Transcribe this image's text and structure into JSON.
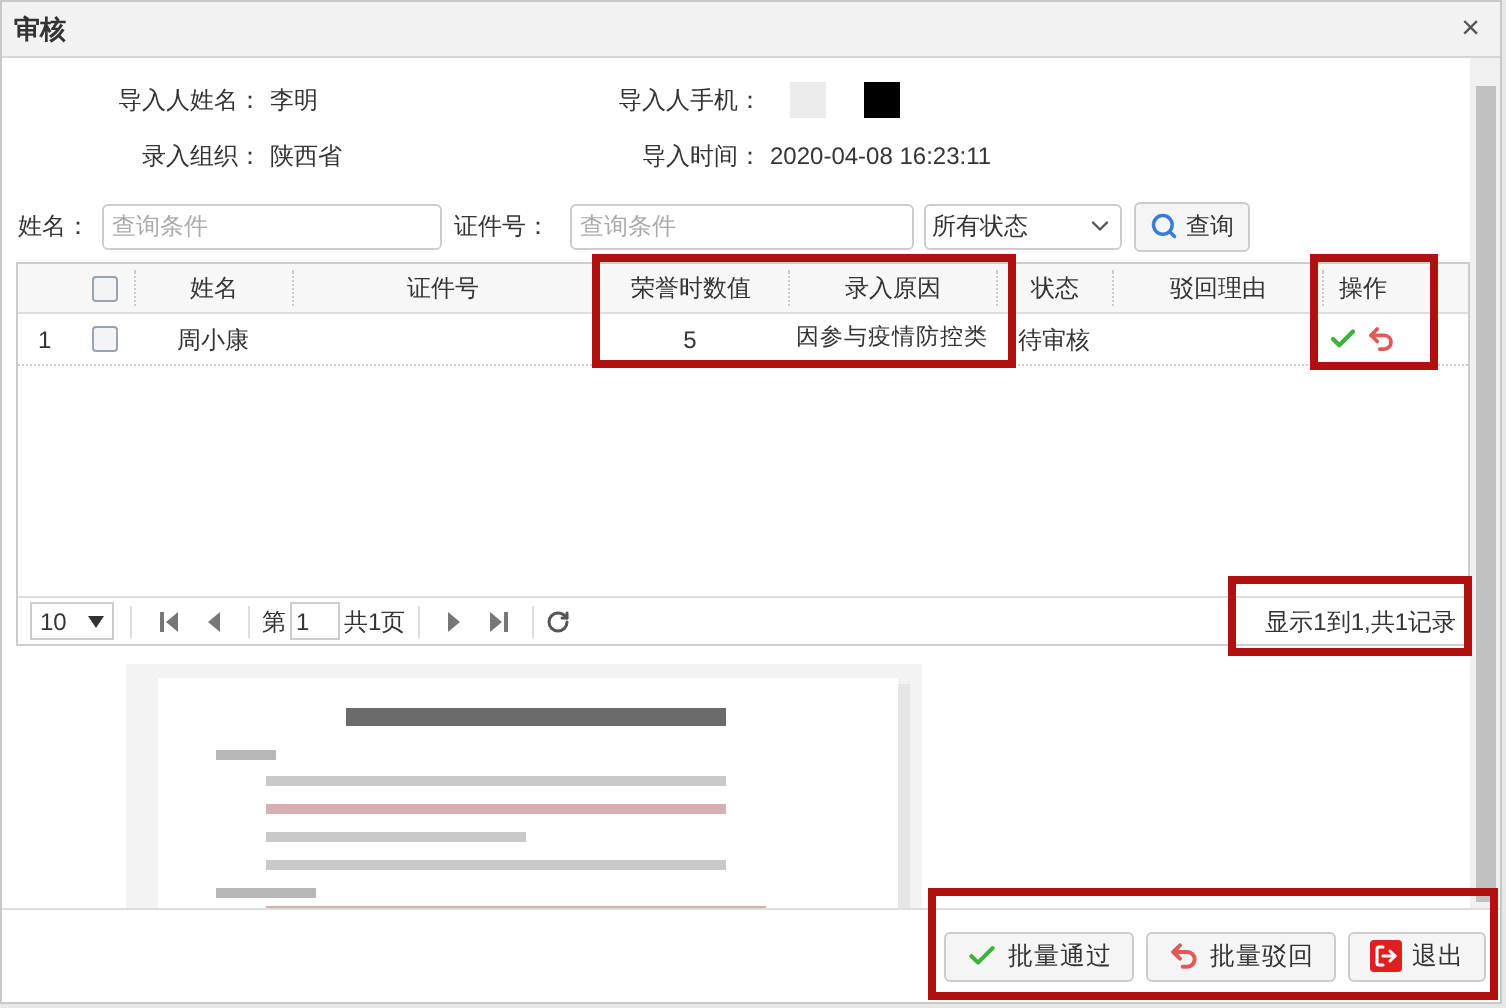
{
  "dialog": {
    "title": "审核",
    "close": "×"
  },
  "info": [
    [
      {
        "label": "导入人姓名：",
        "value": "李明"
      },
      {
        "label": "导入人手机：",
        "kind": "redacted"
      }
    ],
    [
      {
        "label": "录入组织：",
        "value": "陕西省"
      },
      {
        "label": "导入时间：",
        "value": "2020-04-08 16:23:11"
      }
    ]
  ],
  "filters": {
    "name_label": "姓名：",
    "name_placeholder": "查询条件",
    "id_label": "证件号：",
    "id_placeholder": "查询条件",
    "status": "所有状态",
    "search": "查询"
  },
  "table": {
    "all_checked": false,
    "columns": [
      "姓名",
      "证件号",
      "荣誉时数值",
      "录入原因",
      "状态",
      "驳回理由",
      "操作"
    ],
    "rows": [
      {
        "index": "1",
        "checked": false,
        "name": "周小康",
        "hours": "5",
        "reason": "因参与疫情防控类",
        "status": "待审核"
      }
    ]
  },
  "pager": {
    "page_size": "10",
    "page_prefix": "第",
    "page": "1",
    "page_suffix": "共1页",
    "summary": "显示1到1,共1记录"
  },
  "attachment": {
    "kind": "picture"
  },
  "buttons": [
    {
      "label": "批量通过",
      "kind": "approve"
    },
    {
      "label": "批量驳回",
      "kind": "reject"
    },
    {
      "label": "退出",
      "kind": "exit"
    }
  ]
}
